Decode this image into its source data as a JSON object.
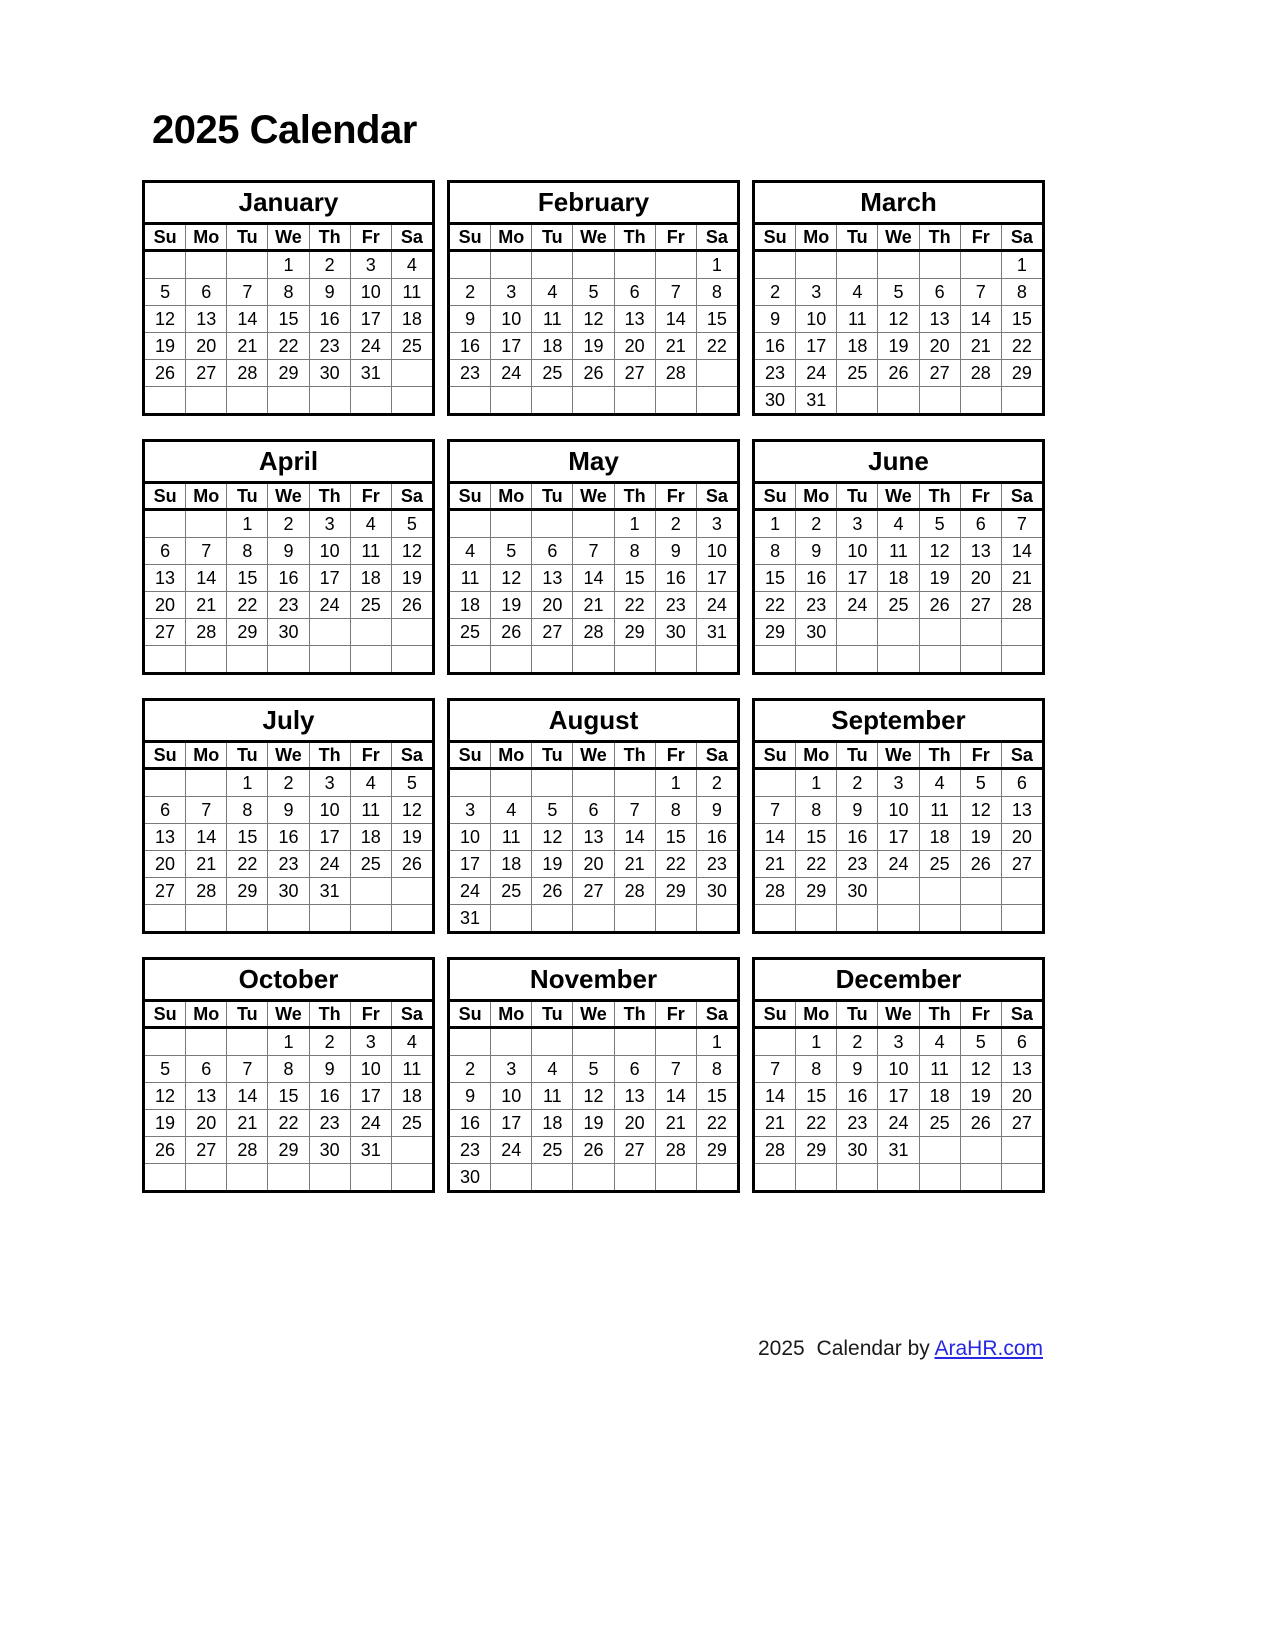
{
  "document": {
    "title": "2025 Calendar",
    "year": "2025"
  },
  "weekday_headers": [
    "Su",
    "Mo",
    "Tu",
    "We",
    "Th",
    "Fr",
    "Sa"
  ],
  "footer": {
    "prefix_year": "2025",
    "text": "Calendar by",
    "link_label": "AraHR.com",
    "link_color": "#2727e6"
  },
  "colors": {
    "text": "#000000",
    "border_outer": "#000000",
    "border_inner": "#7a7a7a",
    "background": "#ffffff",
    "link": "#2727e6"
  },
  "months": [
    {
      "name": "January",
      "weeks": [
        [
          "",
          "",
          "",
          "1",
          "2",
          "3",
          "4"
        ],
        [
          "5",
          "6",
          "7",
          "8",
          "9",
          "10",
          "11"
        ],
        [
          "12",
          "13",
          "14",
          "15",
          "16",
          "17",
          "18"
        ],
        [
          "19",
          "20",
          "21",
          "22",
          "23",
          "24",
          "25"
        ],
        [
          "26",
          "27",
          "28",
          "29",
          "30",
          "31",
          ""
        ],
        [
          "",
          "",
          "",
          "",
          "",
          "",
          ""
        ]
      ]
    },
    {
      "name": "February",
      "weeks": [
        [
          "",
          "",
          "",
          "",
          "",
          "",
          "1"
        ],
        [
          "2",
          "3",
          "4",
          "5",
          "6",
          "7",
          "8"
        ],
        [
          "9",
          "10",
          "11",
          "12",
          "13",
          "14",
          "15"
        ],
        [
          "16",
          "17",
          "18",
          "19",
          "20",
          "21",
          "22"
        ],
        [
          "23",
          "24",
          "25",
          "26",
          "27",
          "28",
          ""
        ],
        [
          "",
          "",
          "",
          "",
          "",
          "",
          ""
        ]
      ]
    },
    {
      "name": "March",
      "weeks": [
        [
          "",
          "",
          "",
          "",
          "",
          "",
          "1"
        ],
        [
          "2",
          "3",
          "4",
          "5",
          "6",
          "7",
          "8"
        ],
        [
          "9",
          "10",
          "11",
          "12",
          "13",
          "14",
          "15"
        ],
        [
          "16",
          "17",
          "18",
          "19",
          "20",
          "21",
          "22"
        ],
        [
          "23",
          "24",
          "25",
          "26",
          "27",
          "28",
          "29"
        ],
        [
          "30",
          "31",
          "",
          "",
          "",
          "",
          ""
        ]
      ]
    },
    {
      "name": "April",
      "weeks": [
        [
          "",
          "",
          "1",
          "2",
          "3",
          "4",
          "5"
        ],
        [
          "6",
          "7",
          "8",
          "9",
          "10",
          "11",
          "12"
        ],
        [
          "13",
          "14",
          "15",
          "16",
          "17",
          "18",
          "19"
        ],
        [
          "20",
          "21",
          "22",
          "23",
          "24",
          "25",
          "26"
        ],
        [
          "27",
          "28",
          "29",
          "30",
          "",
          "",
          ""
        ],
        [
          "",
          "",
          "",
          "",
          "",
          "",
          ""
        ]
      ]
    },
    {
      "name": "May",
      "weeks": [
        [
          "",
          "",
          "",
          "",
          "1",
          "2",
          "3"
        ],
        [
          "4",
          "5",
          "6",
          "7",
          "8",
          "9",
          "10"
        ],
        [
          "11",
          "12",
          "13",
          "14",
          "15",
          "16",
          "17"
        ],
        [
          "18",
          "19",
          "20",
          "21",
          "22",
          "23",
          "24"
        ],
        [
          "25",
          "26",
          "27",
          "28",
          "29",
          "30",
          "31"
        ],
        [
          "",
          "",
          "",
          "",
          "",
          "",
          ""
        ]
      ]
    },
    {
      "name": "June",
      "weeks": [
        [
          "1",
          "2",
          "3",
          "4",
          "5",
          "6",
          "7"
        ],
        [
          "8",
          "9",
          "10",
          "11",
          "12",
          "13",
          "14"
        ],
        [
          "15",
          "16",
          "17",
          "18",
          "19",
          "20",
          "21"
        ],
        [
          "22",
          "23",
          "24",
          "25",
          "26",
          "27",
          "28"
        ],
        [
          "29",
          "30",
          "",
          "",
          "",
          "",
          ""
        ],
        [
          "",
          "",
          "",
          "",
          "",
          "",
          ""
        ]
      ]
    },
    {
      "name": "July",
      "weeks": [
        [
          "",
          "",
          "1",
          "2",
          "3",
          "4",
          "5"
        ],
        [
          "6",
          "7",
          "8",
          "9",
          "10",
          "11",
          "12"
        ],
        [
          "13",
          "14",
          "15",
          "16",
          "17",
          "18",
          "19"
        ],
        [
          "20",
          "21",
          "22",
          "23",
          "24",
          "25",
          "26"
        ],
        [
          "27",
          "28",
          "29",
          "30",
          "31",
          "",
          ""
        ],
        [
          "",
          "",
          "",
          "",
          "",
          "",
          ""
        ]
      ]
    },
    {
      "name": "August",
      "weeks": [
        [
          "",
          "",
          "",
          "",
          "",
          "1",
          "2"
        ],
        [
          "3",
          "4",
          "5",
          "6",
          "7",
          "8",
          "9"
        ],
        [
          "10",
          "11",
          "12",
          "13",
          "14",
          "15",
          "16"
        ],
        [
          "17",
          "18",
          "19",
          "20",
          "21",
          "22",
          "23"
        ],
        [
          "24",
          "25",
          "26",
          "27",
          "28",
          "29",
          "30"
        ],
        [
          "31",
          "",
          "",
          "",
          "",
          "",
          ""
        ]
      ]
    },
    {
      "name": "September",
      "weeks": [
        [
          "",
          "1",
          "2",
          "3",
          "4",
          "5",
          "6"
        ],
        [
          "7",
          "8",
          "9",
          "10",
          "11",
          "12",
          "13"
        ],
        [
          "14",
          "15",
          "16",
          "17",
          "18",
          "19",
          "20"
        ],
        [
          "21",
          "22",
          "23",
          "24",
          "25",
          "26",
          "27"
        ],
        [
          "28",
          "29",
          "30",
          "",
          "",
          "",
          ""
        ],
        [
          "",
          "",
          "",
          "",
          "",
          "",
          ""
        ]
      ]
    },
    {
      "name": "October",
      "weeks": [
        [
          "",
          "",
          "",
          "1",
          "2",
          "3",
          "4"
        ],
        [
          "5",
          "6",
          "7",
          "8",
          "9",
          "10",
          "11"
        ],
        [
          "12",
          "13",
          "14",
          "15",
          "16",
          "17",
          "18"
        ],
        [
          "19",
          "20",
          "21",
          "22",
          "23",
          "24",
          "25"
        ],
        [
          "26",
          "27",
          "28",
          "29",
          "30",
          "31",
          ""
        ],
        [
          "",
          "",
          "",
          "",
          "",
          "",
          ""
        ]
      ]
    },
    {
      "name": "November",
      "weeks": [
        [
          "",
          "",
          "",
          "",
          "",
          "",
          "1"
        ],
        [
          "2",
          "3",
          "4",
          "5",
          "6",
          "7",
          "8"
        ],
        [
          "9",
          "10",
          "11",
          "12",
          "13",
          "14",
          "15"
        ],
        [
          "16",
          "17",
          "18",
          "19",
          "20",
          "21",
          "22"
        ],
        [
          "23",
          "24",
          "25",
          "26",
          "27",
          "28",
          "29"
        ],
        [
          "30",
          "",
          "",
          "",
          "",
          "",
          ""
        ]
      ]
    },
    {
      "name": "December",
      "weeks": [
        [
          "",
          "1",
          "2",
          "3",
          "4",
          "5",
          "6"
        ],
        [
          "7",
          "8",
          "9",
          "10",
          "11",
          "12",
          "13"
        ],
        [
          "14",
          "15",
          "16",
          "17",
          "18",
          "19",
          "20"
        ],
        [
          "21",
          "22",
          "23",
          "24",
          "25",
          "26",
          "27"
        ],
        [
          "28",
          "29",
          "30",
          "31",
          "",
          "",
          ""
        ],
        [
          "",
          "",
          "",
          "",
          "",
          "",
          ""
        ]
      ]
    }
  ]
}
